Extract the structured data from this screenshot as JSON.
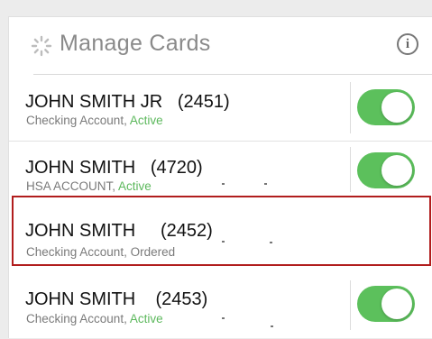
{
  "header": {
    "title": "Manage Cards",
    "spinner_icon": "loading-spinner-icon",
    "info_icon": "info-icon",
    "info_glyph": "i"
  },
  "cards": [
    {
      "name": "JOHN SMITH JR   (2451)",
      "type": "Checking Account,",
      "status": "Active",
      "status_color": "#5cb85c",
      "enabled": true
    },
    {
      "name": "JOHN SMITH   (4720)",
      "type": "HSA ACCOUNT,",
      "status": "Active",
      "status_color": "#5cb85c",
      "enabled": true
    },
    {
      "name": "JOHN SMITH     (2452)",
      "type": "Checking Account,",
      "status": "Ordered",
      "status_color": "#7a7a7a",
      "enabled": null,
      "highlighted": true
    },
    {
      "name": "JOHN SMITH    (2453)",
      "type": "Checking Account,",
      "status": "Active",
      "status_color": "#5cb85c",
      "enabled": true
    }
  ],
  "colors": {
    "toggle_on": "#5cc05c",
    "highlight_border": "#b11d1d",
    "title_text": "#8a8a8a"
  }
}
